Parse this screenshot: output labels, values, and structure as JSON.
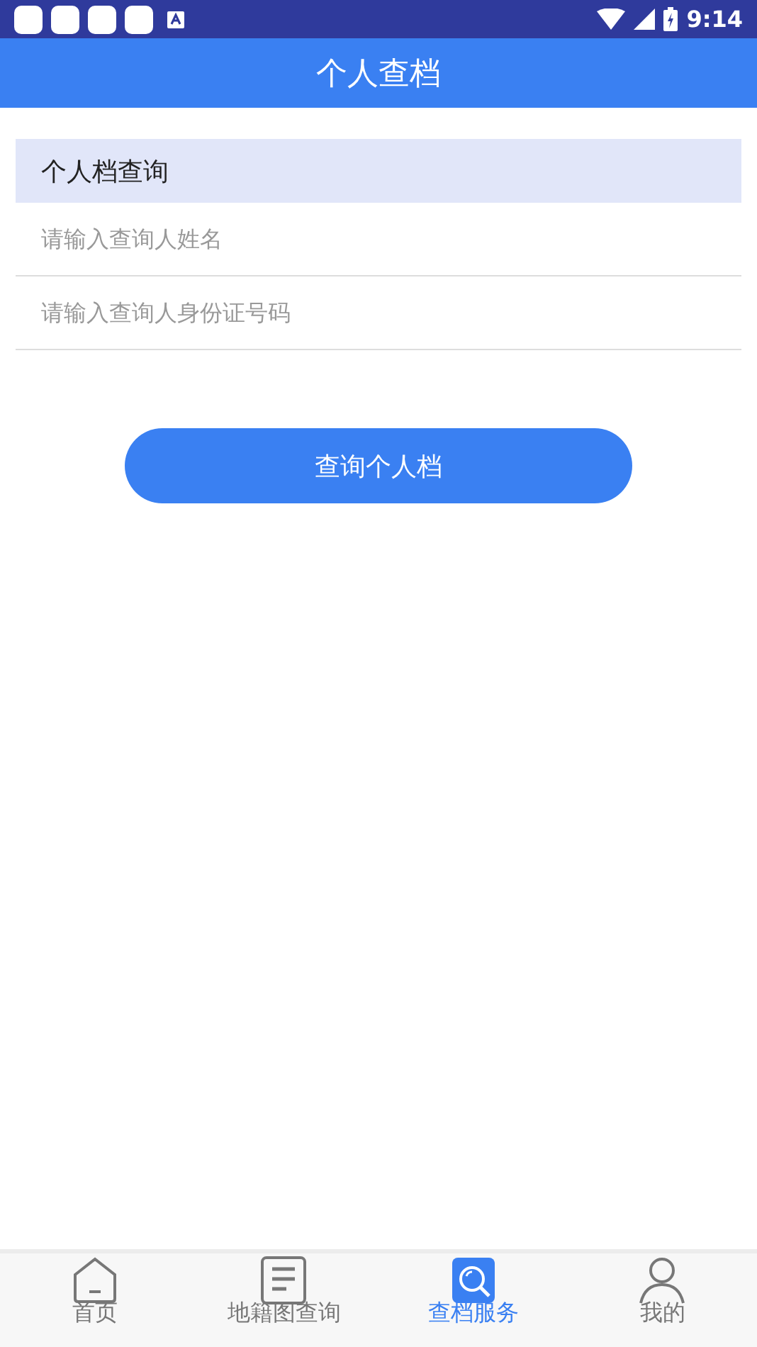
{
  "status_bar": {
    "time": "9:14"
  },
  "header": {
    "title": "个人查档"
  },
  "form": {
    "section_title": "个人档查询",
    "fields": [
      {
        "placeholder": "请输入查询人姓名"
      },
      {
        "placeholder": "请输入查询人身份证号码"
      }
    ],
    "submit": "查询个人档"
  },
  "tab_bar": [
    {
      "label": "首页",
      "selected": false
    },
    {
      "label": "地籍图查询",
      "selected": false
    },
    {
      "label": "查档服务",
      "selected": true
    },
    {
      "label": "我的",
      "selected": false
    }
  ]
}
